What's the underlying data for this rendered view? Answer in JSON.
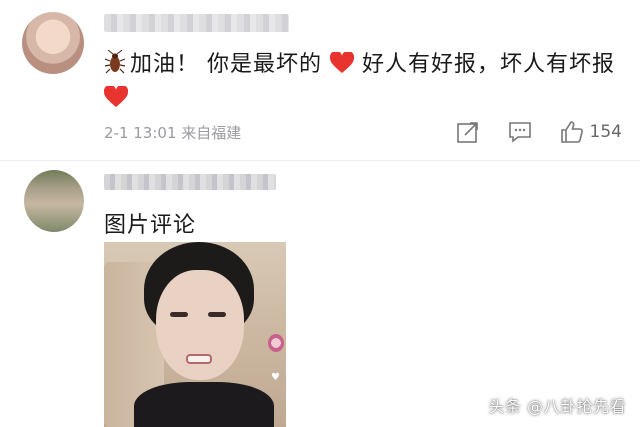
{
  "comment1": {
    "username_label": "",
    "text_part1": "加油！ 你是最坏的",
    "text_part2": "好人有好报，坏人有坏报",
    "timestamp": "2-1 13:01",
    "location": "来自福建",
    "like_count": "154"
  },
  "comment2": {
    "username_label": "",
    "text": "图片评论"
  },
  "watermark": "头条 @八卦抢先看",
  "colors": {
    "heart": "#e8332f",
    "meta_text": "#9a9aa0",
    "body_text": "#1a1a1a"
  },
  "icons": [
    "cockroach-icon",
    "heart-icon",
    "share-icon",
    "comment-icon",
    "like-icon"
  ]
}
